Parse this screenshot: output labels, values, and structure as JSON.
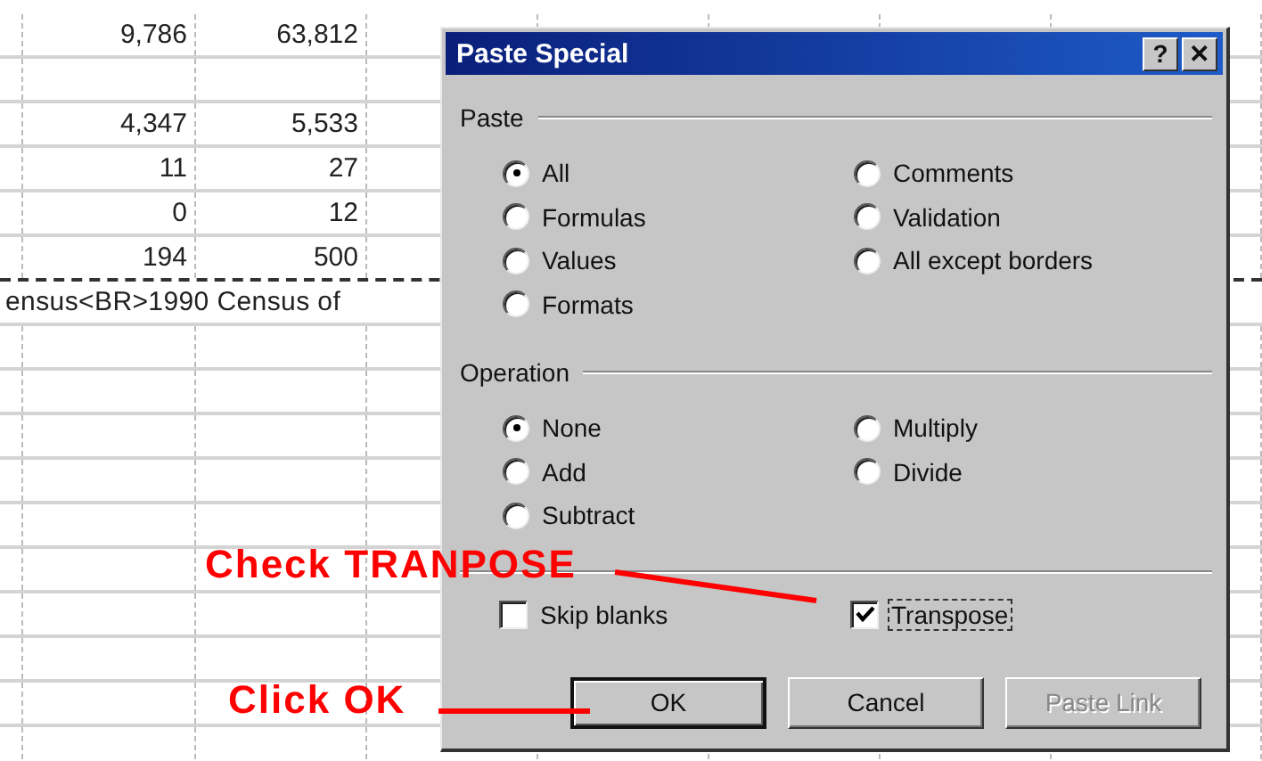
{
  "sheet": {
    "rows": [
      {
        "kind": "values",
        "cells": [
          "9,786",
          "63,812"
        ]
      },
      {
        "kind": "blank"
      },
      {
        "kind": "values",
        "cells": [
          "4,347",
          "5,533"
        ]
      },
      {
        "kind": "values",
        "cells": [
          "11",
          "27"
        ]
      },
      {
        "kind": "values",
        "cells": [
          "0",
          "12"
        ]
      },
      {
        "kind": "values",
        "cells": [
          "194",
          "500"
        ],
        "copy_marquee": true
      },
      {
        "kind": "text",
        "text": "ensus<BR>1990 Census of"
      }
    ]
  },
  "dialog": {
    "title": "Paste Special",
    "title_buttons": [
      "?",
      "✕"
    ],
    "groups": [
      {
        "label": "Paste",
        "options": [
          {
            "label": "All",
            "selected": true
          },
          {
            "label": "Formulas",
            "selected": false
          },
          {
            "label": "Values",
            "selected": false
          },
          {
            "label": "Formats",
            "selected": false
          },
          {
            "label": "Comments",
            "selected": false
          },
          {
            "label": "Validation",
            "selected": false
          },
          {
            "label": "All except borders",
            "selected": false
          }
        ]
      },
      {
        "label": "Operation",
        "options": [
          {
            "label": "None",
            "selected": true
          },
          {
            "label": "Add",
            "selected": false
          },
          {
            "label": "Subtract",
            "selected": false
          },
          {
            "label": "Multiply",
            "selected": false
          },
          {
            "label": "Divide",
            "selected": false
          }
        ]
      }
    ],
    "checkboxes": [
      {
        "label": "Skip blanks",
        "checked": false,
        "focused": false
      },
      {
        "label": "Transpose",
        "checked": true,
        "focused": true
      }
    ],
    "buttons": [
      {
        "label": "OK",
        "default": true,
        "disabled": false
      },
      {
        "label": "Cancel",
        "default": false,
        "disabled": false
      },
      {
        "label": "Paste Link",
        "default": false,
        "disabled": true
      }
    ]
  },
  "annotations": [
    {
      "kind": "check",
      "text": "Check TRANPOSE"
    },
    {
      "kind": "click",
      "text": "Click OK"
    }
  ]
}
